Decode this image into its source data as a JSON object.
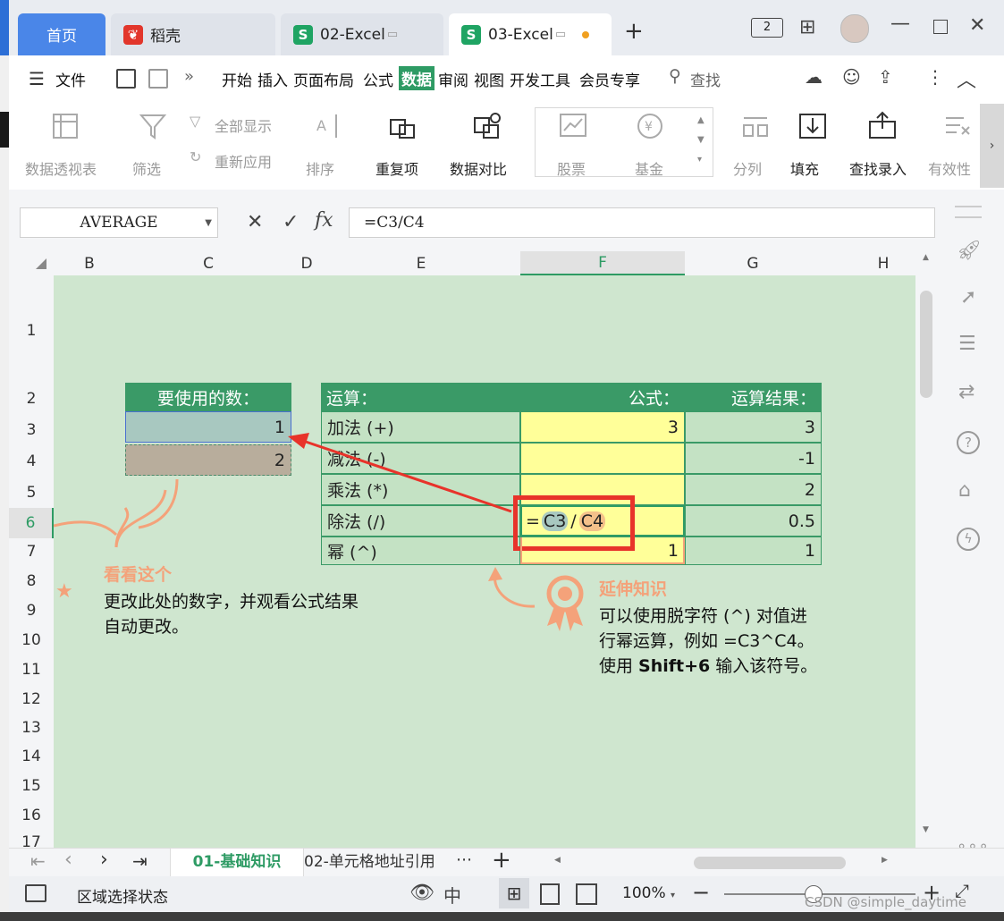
{
  "tabs": [
    {
      "label": "首页"
    },
    {
      "label": "稻壳"
    },
    {
      "label": "02-Excel"
    },
    {
      "label": "03-Excel"
    }
  ],
  "window": {
    "badge": "2"
  },
  "menu": {
    "file": "文件",
    "items": [
      "开始",
      "插入",
      "页面布局",
      "公式",
      "数据",
      "审阅",
      "视图",
      "开发工具",
      "会员专享"
    ],
    "search": "查找"
  },
  "ribbon": {
    "pivot": "数据透视表",
    "filter": "筛选",
    "show_all": "全部显示",
    "reapply": "重新应用",
    "sort": "排序",
    "duplicates": "重复项",
    "compare": "数据对比",
    "stocks": "股票",
    "funds": "基金",
    "split": "分列",
    "fill": "填充",
    "lookup": "查找录入",
    "validity": "有效性"
  },
  "formula_bar": {
    "name_box": "AVERAGE",
    "fx": "fx",
    "formula": "=C3/C4"
  },
  "columns": [
    "B",
    "C",
    "D",
    "E",
    "F",
    "G",
    "H"
  ],
  "rows": [
    "1",
    "2",
    "3",
    "4",
    "5",
    "6",
    "7",
    "8",
    "9",
    "10",
    "11",
    "12",
    "13",
    "14",
    "15",
    "16",
    "17"
  ],
  "numbers_table": {
    "header": "要使用的数：",
    "values": [
      "1",
      "2"
    ]
  },
  "ops_table": {
    "headers": {
      "op": "运算：",
      "formula": "公式：",
      "result": "运算结果："
    },
    "rows": [
      {
        "op": "加法 (+)",
        "formula": "3",
        "result": "3"
      },
      {
        "op": "减法 (-)",
        "formula": "",
        "result": "-1"
      },
      {
        "op": "乘法 (*)",
        "formula": "",
        "result": "2"
      },
      {
        "op": "除法 (/)",
        "formula": "=C3/C4",
        "result": "0.5"
      },
      {
        "op": "幂 (^)",
        "formula": "1",
        "result": "1"
      }
    ],
    "editing": {
      "eq": "=",
      "ref1": "C3",
      "slash": "/",
      "ref2": "C4"
    }
  },
  "note_left": {
    "title": "看看这个",
    "line1": "更改此处的数字，并观看公式结果",
    "line2": "自动更改。"
  },
  "note_right": {
    "title": "延伸知识",
    "line1": "可以使用脱字符 (^) 对值进",
    "line2": "行幂运算，例如 =C3^C4。",
    "line3_a": "使用 ",
    "line3_b": "Shift+6",
    "line3_c": " 输入该符号。"
  },
  "sheet_tabs": [
    "01-基础知识",
    "02-单元格地址引用"
  ],
  "status": {
    "mode": "区域选择状态",
    "zoom": "100%"
  },
  "watermark": "CSDN @simple_daytime",
  "colors": {
    "accent_green": "#2e9b64",
    "header_green": "#3a9a67",
    "sheet_bg": "#cfe6cf",
    "yellow": "#ffff99",
    "orange": "#f4a27a",
    "red": "#e8332a"
  }
}
